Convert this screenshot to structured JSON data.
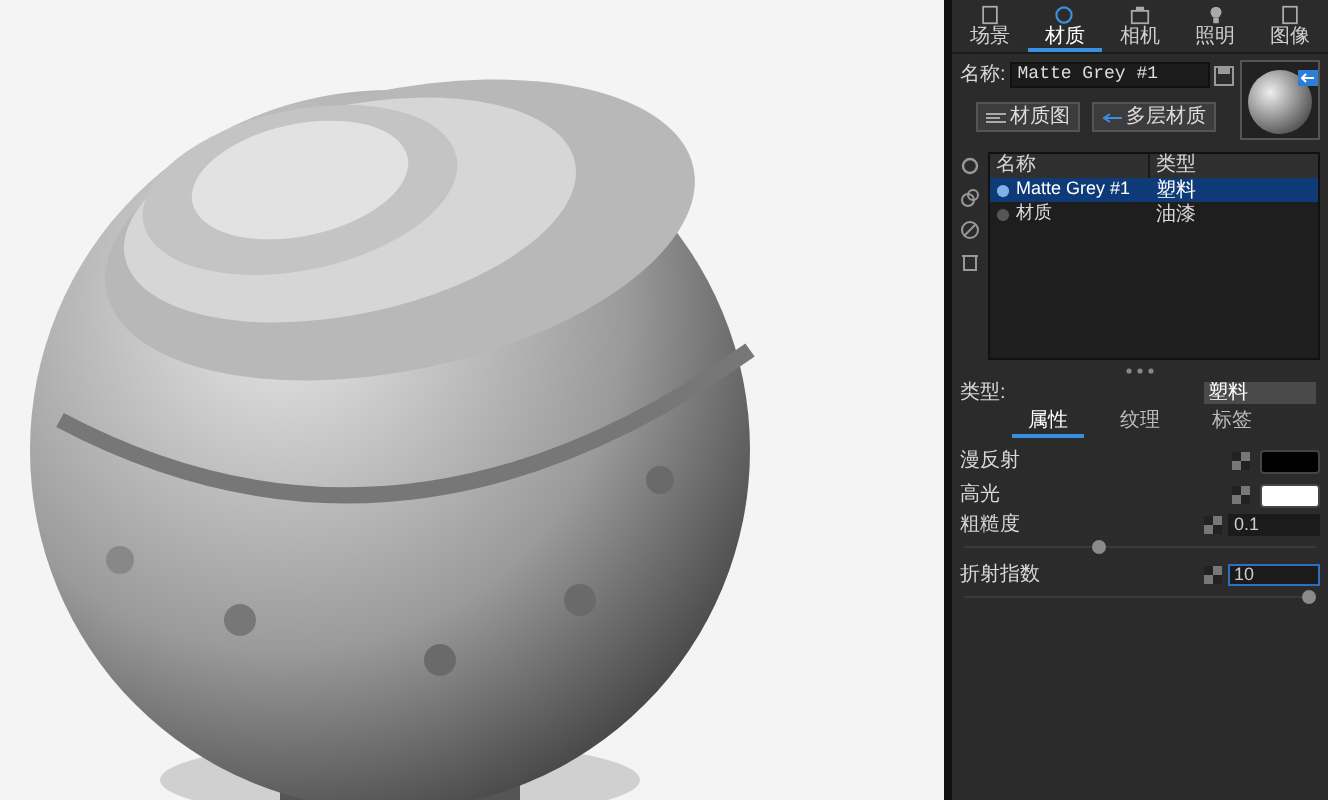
{
  "viewport": {
    "kind": "picture"
  },
  "tabs": [
    {
      "label": "场景",
      "selected": false
    },
    {
      "label": "材质",
      "selected": true
    },
    {
      "label": "相机",
      "selected": false
    },
    {
      "label": "照明",
      "selected": false
    },
    {
      "label": "图像",
      "selected": false
    }
  ],
  "name_field": {
    "label": "名称:",
    "value": "Matte Grey #1"
  },
  "buttons": [
    "材质图",
    "多层材质"
  ],
  "material_table": {
    "columns": [
      "名称",
      "类型"
    ],
    "rows": [
      {
        "name": "Matte Grey #1",
        "type": "塑料",
        "selected": true
      },
      {
        "name": "材质",
        "type": "油漆",
        "selected": false
      }
    ]
  },
  "type_field": {
    "label": "类型:",
    "value": "塑料"
  },
  "sub_tabs": [
    {
      "label": "属性",
      "selected": true
    },
    {
      "label": "纹理",
      "selected": false
    },
    {
      "label": "标签",
      "selected": false
    }
  ],
  "properties": [
    {
      "kind": "color",
      "label": "漫反射",
      "color": "#000000"
    },
    {
      "kind": "color",
      "label": "高光",
      "color": "#ffffff"
    },
    {
      "kind": "slider",
      "label": "粗糙度",
      "value": "0.1",
      "level": 0.38,
      "focused": false
    },
    {
      "kind": "slider",
      "label": "折射指数",
      "value": "10",
      "level": 1,
      "focused": true
    }
  ]
}
